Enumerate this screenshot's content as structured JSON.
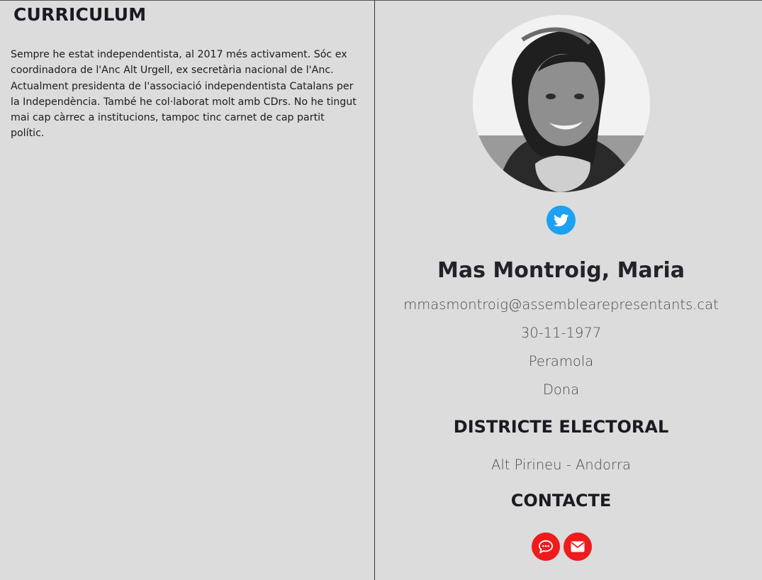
{
  "curriculum": {
    "title": "CURRICULUM",
    "text": "Sempre he estat independentista, al 2017 més activament. Sóc ex coordinadora de l'Anc Alt Urgell, ex secretària nacional de l'Anc. Actualment presidenta de l'associació independentista Catalans per la Independència. També he col·laborat molt amb CDrs. No he tingut mai cap càrrec a institucions, tampoc tinc carnet de cap partit polític."
  },
  "profile": {
    "name": "Mas Montroig, Maria",
    "email": "mmasmontroig@assemblearepresentants.cat",
    "birthdate": "30-11-1977",
    "town": "Peramola",
    "gender": "Dona",
    "photo_icon": "profile-photo",
    "social_icon": "twitter-icon"
  },
  "district": {
    "title": "DISTRICTE ELECTORAL",
    "value": "Alt Pirineu - Andorra"
  },
  "contact": {
    "title": "CONTACTE",
    "buttons": [
      {
        "icon": "chat-icon"
      },
      {
        "icon": "mail-icon"
      }
    ]
  },
  "colors": {
    "background": "#dcdcdc",
    "twitter": "#1da1f2",
    "contact": "#ee1c1c"
  }
}
